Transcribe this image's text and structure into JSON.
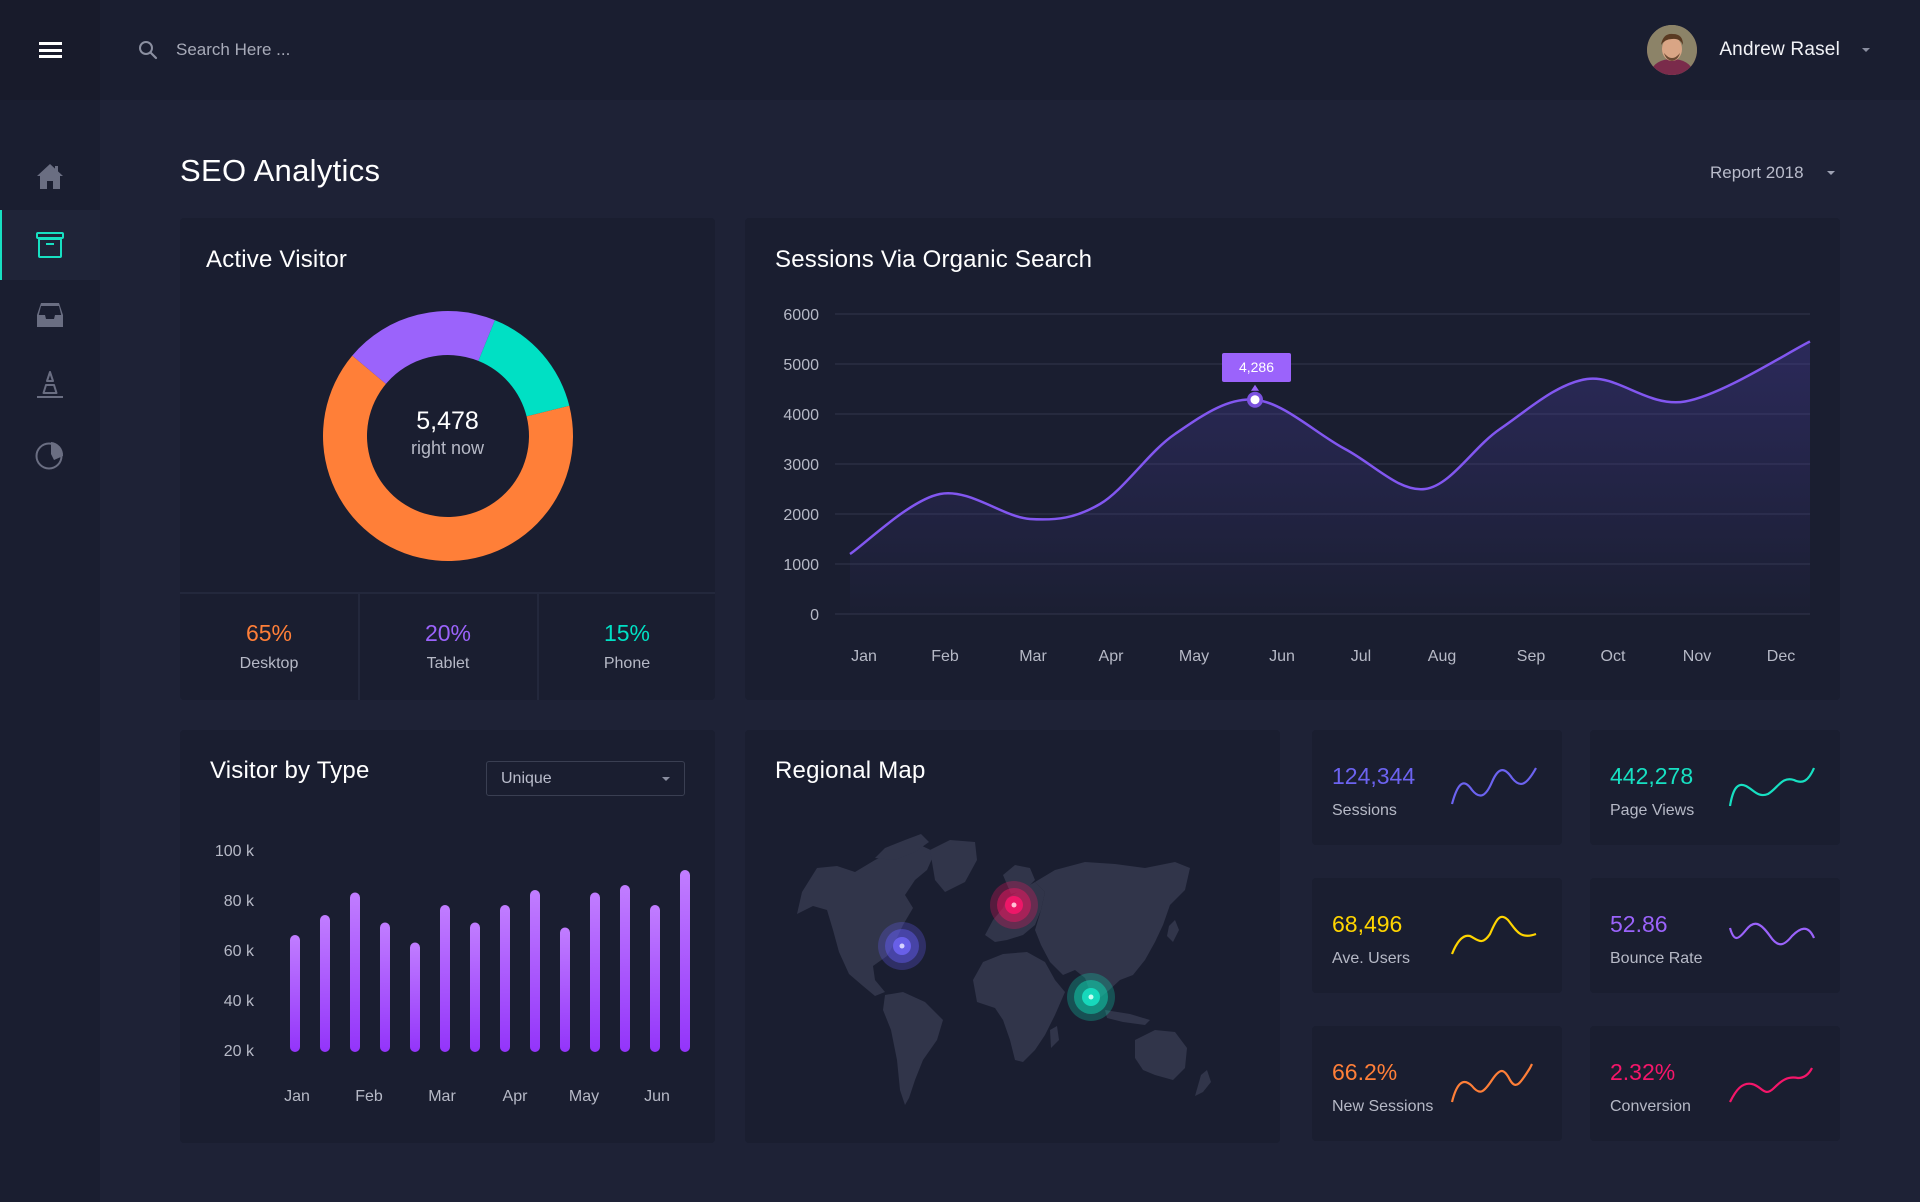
{
  "topbar": {
    "search_placeholder": "Search Here ...",
    "search_icon": "search-icon",
    "menu_icon": "hamburger-menu-icon",
    "user_name": "Andrew Rasel",
    "user_avatar": "avatar-photo"
  },
  "sidebar": {
    "items": [
      {
        "name": "home",
        "icon": "home-icon",
        "active": false
      },
      {
        "name": "archive",
        "icon": "archive-box-icon",
        "active": true
      },
      {
        "name": "inbox",
        "icon": "inbox-tray-icon",
        "active": false
      },
      {
        "name": "cone",
        "icon": "traffic-cone-icon",
        "active": false
      },
      {
        "name": "pie",
        "icon": "pie-chart-icon",
        "active": false
      }
    ],
    "accent": "#17e0c2"
  },
  "page": {
    "title": "SEO Analytics",
    "report_selector": "Report 2018"
  },
  "active_visitor": {
    "title": "Active Visitor",
    "center_value": "5,478",
    "center_label": "right now",
    "segments": [
      {
        "label": "Desktop",
        "percent": 65,
        "display": "65%",
        "color": "#ff7f38"
      },
      {
        "label": "Tablet",
        "percent": 20,
        "display": "20%",
        "color": "#9b63fb"
      },
      {
        "label": "Phone",
        "percent": 15,
        "display": "15%",
        "color": "#00e0c4"
      }
    ]
  },
  "sessions": {
    "title": "Sessions Via Organic Search",
    "tooltip": "4,286"
  },
  "visitor_by_type": {
    "title": "Visitor by Type",
    "select_value": "Unique"
  },
  "regional_map": {
    "title": "Regional Map",
    "markers": [
      {
        "region": "North America",
        "color": "#5f5ae6"
      },
      {
        "region": "Europe",
        "color": "#e5175f"
      },
      {
        "region": "South Asia",
        "color": "#12c9a8"
      }
    ]
  },
  "kpis": [
    {
      "value": "124,344",
      "label": "Sessions",
      "color": "#6c63f0"
    },
    {
      "value": "442,278",
      "label": "Page Views",
      "color": "#17e0c2"
    },
    {
      "value": "68,496",
      "label": "Ave. Users",
      "color": "#ffd500"
    },
    {
      "value": "52.86",
      "label": "Bounce Rate",
      "color": "#9b63fb"
    },
    {
      "value": "66.2%",
      "label": "New Sessions",
      "color": "#ff7f38"
    },
    {
      "value": "2.32%",
      "label": "Conversion",
      "color": "#f5166a"
    }
  ],
  "chart_data": [
    {
      "type": "pie",
      "title": "Active Visitor",
      "categories": [
        "Desktop",
        "Tablet",
        "Phone"
      ],
      "values": [
        65,
        20,
        15
      ],
      "center_text": "5,478 right now"
    },
    {
      "type": "area",
      "title": "Sessions Via Organic Search",
      "x": [
        "Jan",
        "Feb",
        "Mar",
        "Apr",
        "May",
        "Jun",
        "Jul",
        "Aug",
        "Sep",
        "Oct",
        "Nov",
        "Dec"
      ],
      "series": [
        {
          "name": "Sessions",
          "values": [
            1200,
            2400,
            1900,
            2200,
            3600,
            4286,
            3300,
            2500,
            3700,
            4700,
            4250,
            5450
          ]
        }
      ],
      "yticks": [
        0,
        1000,
        2000,
        3000,
        4000,
        5000,
        6000
      ],
      "ylim": [
        0,
        6000
      ],
      "grid": true,
      "highlight": {
        "x": "Jun",
        "value": 4286,
        "label": "4,286"
      },
      "color": "#8257f0"
    },
    {
      "type": "bar",
      "title": "Visitor by Type",
      "categories": [
        "Jan",
        "",
        "Feb",
        "",
        "Mar",
        "",
        "Apr",
        "",
        "May",
        "",
        "Jun",
        ""
      ],
      "x_labels": [
        "Jan",
        "Feb",
        "Mar",
        "Apr",
        "May",
        "Jun"
      ],
      "values": [
        66,
        74,
        83,
        71,
        63,
        78,
        71,
        78,
        84,
        69,
        83,
        86,
        78,
        92
      ],
      "yticks": [
        "20 k",
        "40 k",
        "60 k",
        "80 k",
        "100 k"
      ],
      "ylim": [
        20,
        100
      ],
      "ylabel": "",
      "unit": "k",
      "color_top": "#c17dff",
      "color_bottom": "#9334fa"
    }
  ]
}
